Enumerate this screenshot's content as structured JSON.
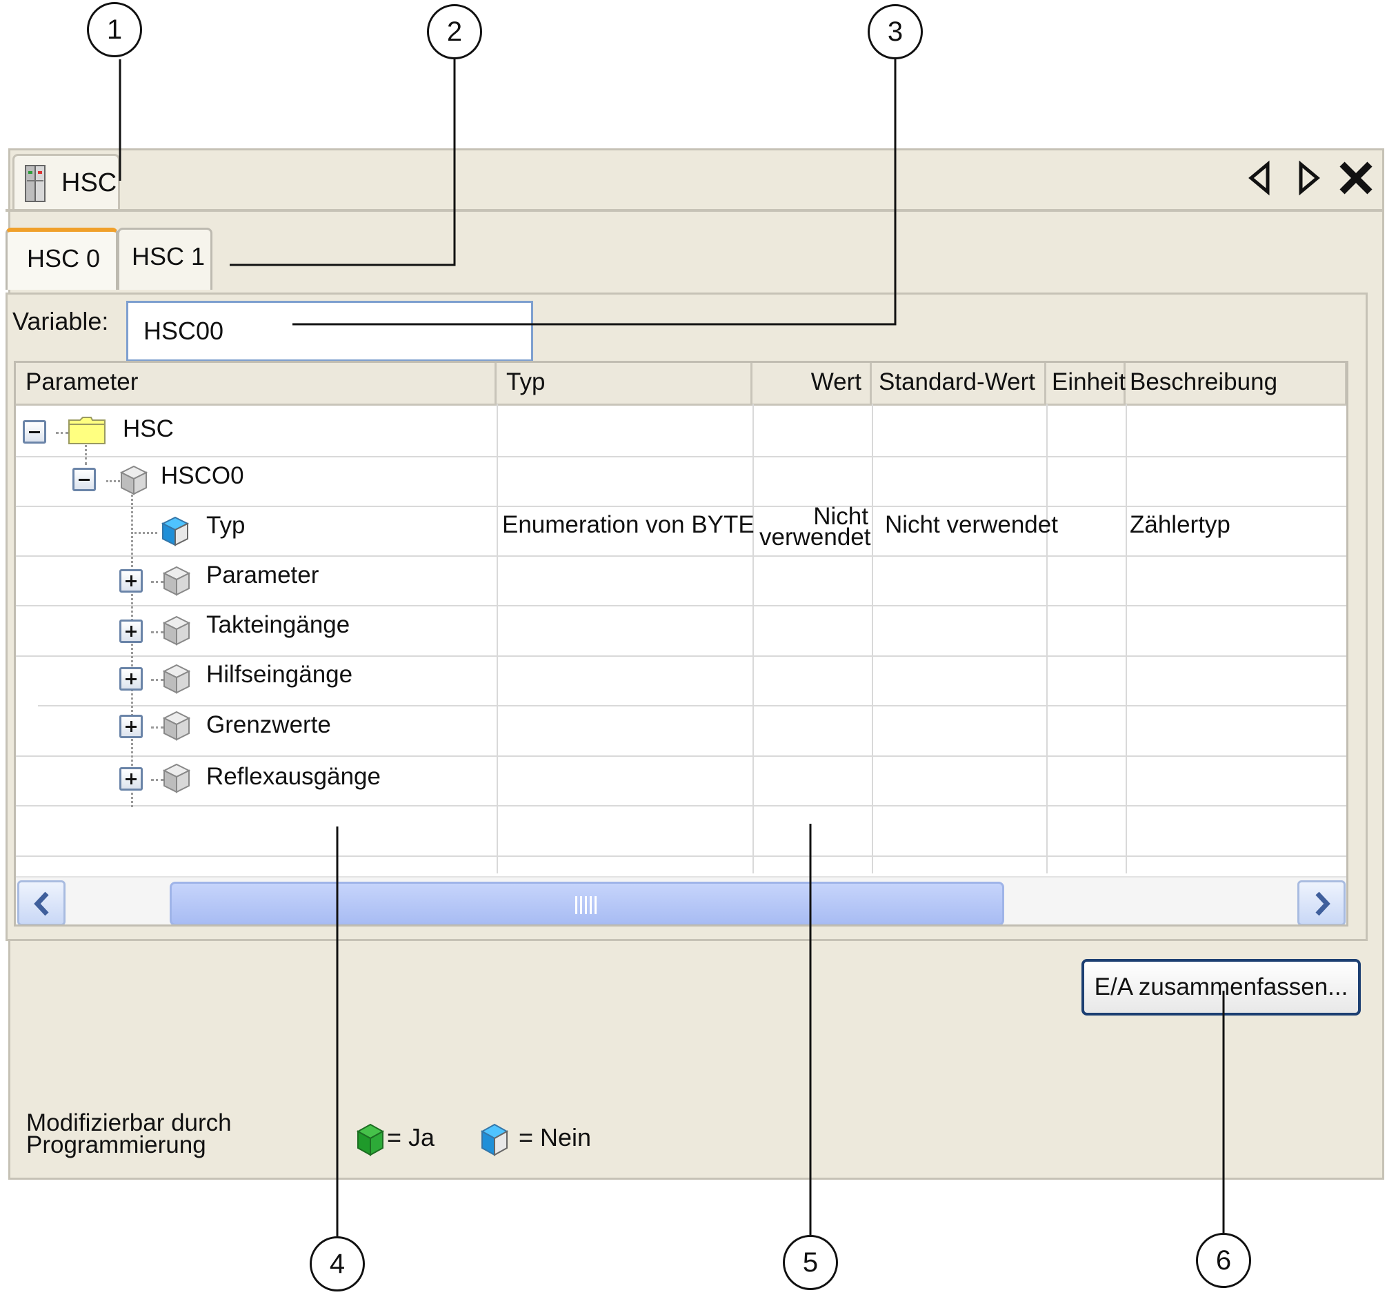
{
  "window": {
    "tab_label": "HSC",
    "tab_icon": "controller-module-icon"
  },
  "subtabs": [
    {
      "label": "HSC 0",
      "active": true
    },
    {
      "label": "HSC 1",
      "active": false
    }
  ],
  "variable": {
    "label": "Variable:",
    "value": "HSC00"
  },
  "table": {
    "columns": [
      "Parameter",
      "Typ",
      "Wert",
      "Standard-Wert",
      "Einheit",
      "Beschreibung"
    ],
    "rows": [
      {
        "name": "HSC",
        "icon": "folder-icon",
        "expander": "minus",
        "typ": "",
        "wert": "",
        "standard": "",
        "einheit": "",
        "beschreibung": ""
      },
      {
        "name": "HSCO0",
        "icon": "grey-cube-icon",
        "expander": "minus",
        "typ": "",
        "wert": "",
        "standard": "",
        "einheit": "",
        "beschreibung": ""
      },
      {
        "name": "Typ",
        "icon": "blue-cube-icon",
        "expander": "",
        "typ": "Enumeration von BYTE",
        "wert_line1": "Nicht",
        "wert_line2": "verwendet",
        "standard": "Nicht verwendet",
        "einheit": "",
        "beschreibung": "Zählertyp"
      },
      {
        "name": "Parameter",
        "icon": "grey-cube-icon",
        "expander": "plus"
      },
      {
        "name": "Takteingänge",
        "icon": "grey-cube-icon",
        "expander": "plus"
      },
      {
        "name": "Hilfseingänge",
        "icon": "grey-cube-icon",
        "expander": "plus"
      },
      {
        "name": "Grenzwerte",
        "icon": "grey-cube-icon",
        "expander": "plus"
      },
      {
        "name": "Reflexausgänge",
        "icon": "grey-cube-icon",
        "expander": "plus"
      }
    ]
  },
  "actions": {
    "summarize_label": "E/A zusammenfassen..."
  },
  "legend": {
    "title": "Modifizierbar durch Programmierung",
    "yes_label": "= Ja",
    "no_label": "= Nein"
  },
  "callouts": [
    "1",
    "2",
    "3",
    "4",
    "5",
    "6"
  ],
  "colors": {
    "background": "#ede9dc",
    "active_tab_accent": "#f0a02a",
    "folder": "#ffff80",
    "cube_grey": "#c8c8c8",
    "cube_blue": "#2aa5e8",
    "cube_green": "#1f9a2a",
    "button_border": "#1c3f72",
    "scroll_thumb": "#b3c5f6"
  }
}
